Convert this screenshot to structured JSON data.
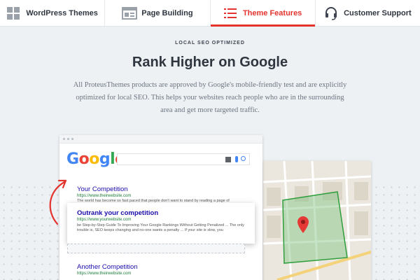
{
  "tabs": [
    {
      "label": "WordPress Themes",
      "icon": "grid-icon",
      "active": false
    },
    {
      "label": "Page Building",
      "icon": "layout-icon",
      "active": false
    },
    {
      "label": "Theme Features",
      "icon": "list-icon",
      "active": true
    },
    {
      "label": "Customer Support",
      "icon": "headset-icon",
      "active": false
    }
  ],
  "section": {
    "eyebrow": "LOCAL SEO OPTIMIZED",
    "headline": "Rank Higher on Google",
    "description": "All ProteusThemes products are approved by Google's mobile-friendly test and are explicitly optimized for local SEO. This helps your websites reach people who are in the surrounding area and get more targeted traffic."
  },
  "google": {
    "logo_letters": [
      "G",
      "o",
      "o",
      "g",
      "l",
      "e"
    ],
    "results": [
      {
        "title": "Your Competition",
        "url": "https://www.theirwebsite.com",
        "snippet": "The world has become so fast paced that people don't want to stand by reading a page of"
      },
      {
        "title": "Outrank your competition",
        "url": "https://www.yourwebsite.com",
        "snippet": "be Step-by-Step Guide To Improving Your Google Rankings Without Getting Penalized ... The only trouble is, SEO keeps changing and no-one wants a penalty ... If your site is slow, you"
      },
      {
        "title": "Another Competition",
        "url": "https://www.theirwebsite.com"
      }
    ]
  },
  "colors": {
    "accent": "#e3342f",
    "google_blue": "#4285f4",
    "google_red": "#ea4335",
    "google_yellow": "#fbbc05",
    "google_green": "#34a853",
    "map_area": "#7cc47f",
    "pin": "#e53935"
  }
}
